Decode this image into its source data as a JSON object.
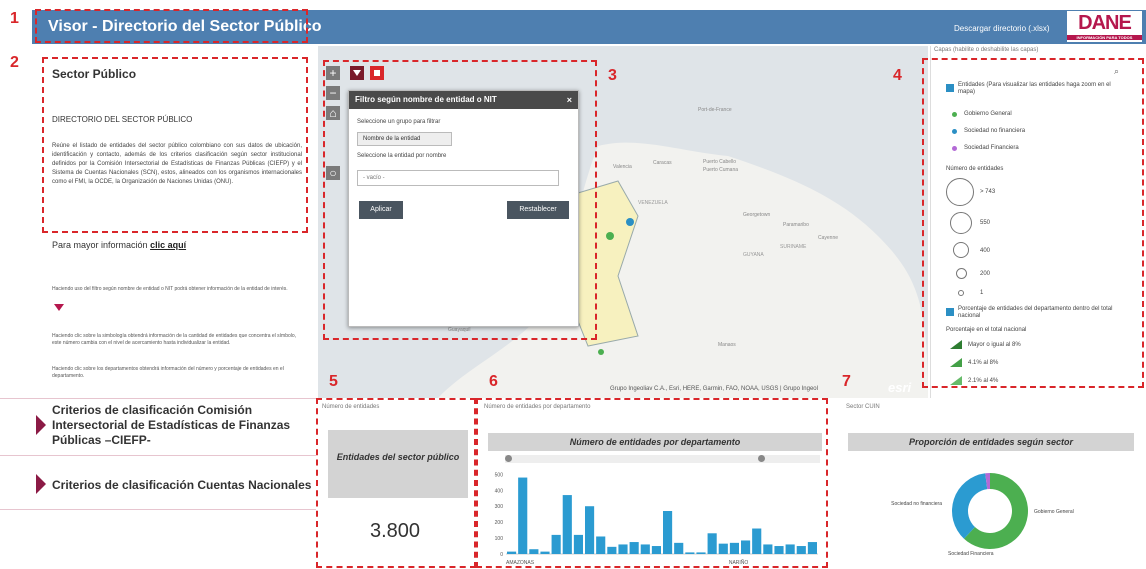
{
  "header": {
    "title": "Visor - Directorio del Sector Público",
    "download_link": "Descargar directorio (.xlsx)",
    "logo_text": "DANE",
    "logo_subtext": "INFORMACIÓN PARA TODOS"
  },
  "annotations": [
    "1",
    "2",
    "3",
    "4",
    "5",
    "6",
    "7"
  ],
  "sidebar": {
    "title": "Sector Público",
    "heading": "DIRECTORIO DEL SECTOR PÚBLICO",
    "description": "Reúne el listado de entidades del sector público colombiano con sus datos de ubicación, identificación y contacto, además de los criterios clasificación según sector institucional definidos por la Comisión Intersectorial de Estadísticas de Finanzas Públicas (CIEFP) y el Sistema de Cuentas Nacionales (SCN), estos, alineados con los organismos internacionales como el FMI, la OCDE, la Organización de Naciones Unidas (ONU).",
    "more_info_text": "Para mayor información",
    "more_info_link": "clic aquí",
    "help_filter": "Haciendo uso del filtro según nombre de entidad o NIT podrá obtener información de la entidad de interés.",
    "help_symbol": "Haciendo clic sobre la simbología obtendrá información de la cantidad de entidades que concentra el símbolo, este número cambia con el nivel de acercamiento hasta individualizar la entidad.",
    "help_departments": "Haciendo clic sobre los departamentos obtendrá información del número y porcentaje de entidades en el departamento.",
    "criteria": [
      "Criterios de clasificación Comisión Intersectorial de Estadísticas de Finanzas Públicas –CIEFP-",
      "Criterios de clasificación Cuentas Nacionales"
    ]
  },
  "map": {
    "tools": [
      "+",
      "−",
      "⌂",
      "○"
    ],
    "labels": [
      "Port-de-France",
      "Caracas",
      "Puerto Cabello",
      "Valencia",
      "Puerto Cumana",
      "VENEZUELA",
      "Georgetown",
      "Paramaribo",
      "Cayenne",
      "SURINAME",
      "GUYANA",
      "Guayaquil",
      "Manaos"
    ],
    "attribution": "Grupo Ingeoliav C.A., Esri, HERE, Garmin, FAO, NOAA, USGS | Grupo Ingeol",
    "esri": "esri"
  },
  "filter_dialog": {
    "title": "Filtro según nombre de entidad o NIT",
    "close": "×",
    "group_label": "Seleccione un grupo para filtrar",
    "group_value": "Nombre de la entidad",
    "entity_label": "Seleccione la entidad por nombre",
    "entity_placeholder": "- vacío -",
    "apply": "Aplicar",
    "reset": "Restablecer"
  },
  "layers": {
    "caption": "Capas (habilite o deshabilite las capas)",
    "layer1_title": "Entidades (Para visualizar las entidades haga zoom en el mapa)",
    "categories": [
      {
        "label": "Gobierno General",
        "color": "#4caf50"
      },
      {
        "label": "Sociedad no financiera",
        "color": "#2b8fc4"
      },
      {
        "label": "Sociedad Financiera",
        "color": "#b36ad6"
      }
    ],
    "size_title": "Número de entidades",
    "sizes": [
      "> 743",
      "550",
      "400",
      "200",
      "1"
    ],
    "layer2_title": "Porcentaje de entidades del departamento dentro del total nacional",
    "pct_title": "Porcentaje en el total nacional",
    "pct_items": [
      "Mayor o igual al 8%",
      "4.1% al 8%",
      "2.1% al 4%"
    ]
  },
  "widget_total": {
    "caption": "Número de entidades",
    "title": "Entidades del sector público",
    "value": "3.800"
  },
  "widget_bars": {
    "caption": "Número de entidades por departamento",
    "title": "Número de entidades por departamento"
  },
  "widget_donut": {
    "caption": "Sector CUIN",
    "title": "Proporción de entidades según sector"
  },
  "chart_data": [
    {
      "type": "bar",
      "title": "Número de entidades por departamento",
      "categories_labeled": [
        "AMAZONAS",
        "NARIÑO"
      ],
      "values": [
        15,
        480,
        30,
        15,
        120,
        370,
        120,
        300,
        110,
        45,
        60,
        75,
        60,
        50,
        270,
        70,
        10,
        10,
        130,
        65,
        70,
        85,
        160,
        60,
        50,
        60,
        50,
        75
      ],
      "yticks": [
        0,
        100,
        200,
        300,
        400,
        500
      ],
      "ylim": [
        0,
        540
      ],
      "color": "#2b9bd1"
    },
    {
      "type": "pie",
      "title": "Proporción de entidades según sector",
      "slices": [
        {
          "label": "Gobierno General",
          "value": 62,
          "color": "#4caf50"
        },
        {
          "label": "Sociedad no financiera",
          "value": 36,
          "color": "#2b9bd1"
        },
        {
          "label": "Sociedad Financiera",
          "value": 2,
          "color": "#b36ad6"
        }
      ]
    }
  ]
}
